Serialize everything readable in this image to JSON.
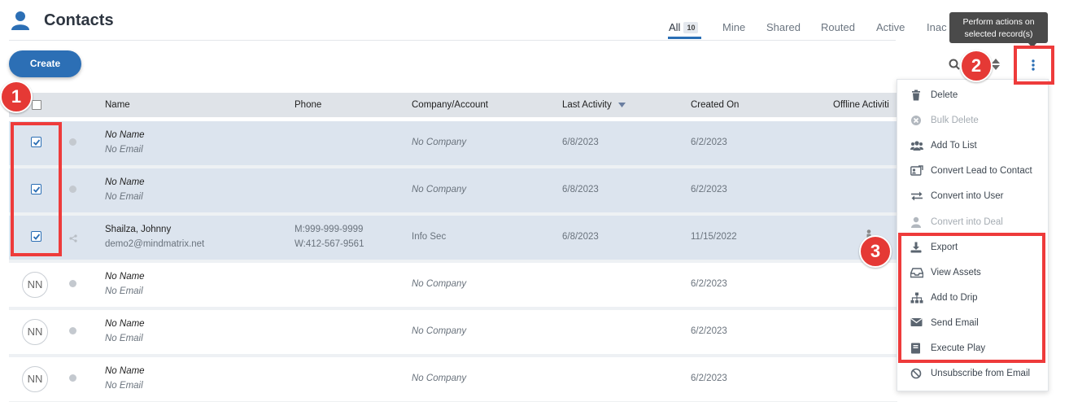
{
  "page": {
    "title": "Contacts",
    "icon": "user-icon"
  },
  "tabs": [
    {
      "label": "All",
      "count": "10"
    },
    {
      "label": "Mine"
    },
    {
      "label": "Shared"
    },
    {
      "label": "Routed"
    },
    {
      "label": "Active"
    },
    {
      "label": "Inac"
    }
  ],
  "toolbar": {
    "create_label": "Create"
  },
  "tooltip": {
    "line1": "Perform actions on",
    "line2": "selected record(s)"
  },
  "table": {
    "columns": [
      "Name",
      "Phone",
      "Company/Account",
      "Last Activity",
      "Created On",
      "Offline Activiti"
    ],
    "rows": [
      {
        "name": "No Name",
        "email": "No Email",
        "phone1": "",
        "phone2": "",
        "company": "No Company",
        "last_activity": "6/8/2023",
        "created_on": "6/2/2023",
        "initials": ""
      },
      {
        "name": "No Name",
        "email": "No Email",
        "phone1": "",
        "phone2": "",
        "company": "No Company",
        "last_activity": "6/8/2023",
        "created_on": "6/2/2023",
        "initials": ""
      },
      {
        "name": "Shailza, Johnny",
        "email": "demo2@mindmatrix.net",
        "phone1": "M:999-999-9999",
        "phone2": "W:412-567-9561",
        "company": "Info Sec",
        "last_activity": "6/8/2023",
        "created_on": "11/15/2022",
        "initials": ""
      },
      {
        "name": "No Name",
        "email": "No Email",
        "phone1": "",
        "phone2": "",
        "company": "No Company",
        "last_activity": "",
        "created_on": "6/2/2023",
        "initials": "NN"
      },
      {
        "name": "No Name",
        "email": "No Email",
        "phone1": "",
        "phone2": "",
        "company": "No Company",
        "last_activity": "",
        "created_on": "6/2/2023",
        "initials": "NN"
      },
      {
        "name": "No Name",
        "email": "No Email",
        "phone1": "",
        "phone2": "",
        "company": "No Company",
        "last_activity": "",
        "created_on": "6/2/2023",
        "initials": "NN"
      }
    ]
  },
  "menu": {
    "items": [
      {
        "label": "Delete",
        "icon": "trash-icon",
        "disabled": false
      },
      {
        "label": "Bulk Delete",
        "icon": "circle-x-icon",
        "disabled": true
      },
      {
        "label": "Add To List",
        "icon": "users-icon",
        "disabled": false
      },
      {
        "label": "Convert Lead to Contact",
        "icon": "id-card-icon",
        "disabled": false
      },
      {
        "label": "Convert into User",
        "icon": "swap-arrows-icon",
        "disabled": false
      },
      {
        "label": "Convert into Deal",
        "icon": "user-icon",
        "disabled": true
      },
      {
        "label": "Export",
        "icon": "download-icon",
        "disabled": false
      },
      {
        "label": "View Assets",
        "icon": "inbox-icon",
        "disabled": false
      },
      {
        "label": "Add to Drip",
        "icon": "sitemap-icon",
        "disabled": false
      },
      {
        "label": "Send Email",
        "icon": "envelope-icon",
        "disabled": false
      },
      {
        "label": "Execute Play",
        "icon": "book-icon",
        "disabled": false
      },
      {
        "label": "Unsubscribe from Email",
        "icon": "ban-icon",
        "disabled": false
      }
    ]
  },
  "annotations": {
    "badge1": "1",
    "badge2": "2",
    "badge3": "3"
  },
  "colors": {
    "accent": "#2c6fb5",
    "callout": "#ee3b3b",
    "selected_row": "#dce4ee"
  }
}
